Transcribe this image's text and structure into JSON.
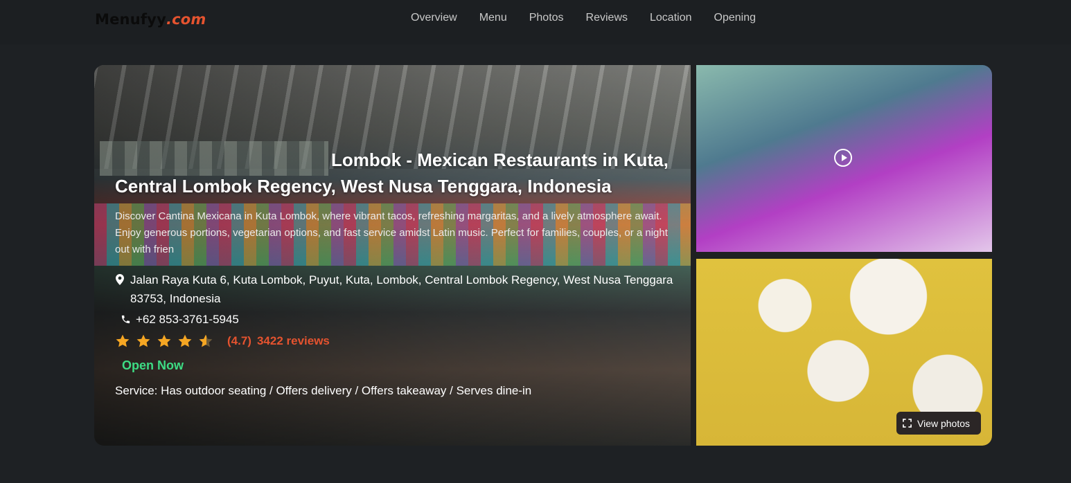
{
  "brand": {
    "name": "Menufyy",
    "tld": ".com"
  },
  "nav": [
    "Overview",
    "Menu",
    "Photos",
    "Reviews",
    "Location",
    "Opening"
  ],
  "restaurant": {
    "title": "Lombok - Mexican Restaurants in Kuta, Central Lombok Regency, West Nusa Tenggara, Indonesia",
    "description": "Discover Cantina Mexicana in Kuta Lombok, where vibrant tacos, refreshing margaritas, and a lively atmosphere await. Enjoy generous portions, vegetarian options, and fast service amidst Latin music. Perfect for families, couples, or a night out with frien",
    "address": "Jalan Raya Kuta 6, Kuta Lombok, Puyut, Kuta, Lombok, Central Lombok Regency, West Nusa Tenggara 83753, Indonesia",
    "phone": "+62 853-3761-5945",
    "rating": 4.7,
    "rating_text": "(4.7)",
    "reviews_text": "3422 reviews",
    "status": "Open Now",
    "service": "Service: Has outdoor seating / Offers delivery / Offers takeaway / Serves dine-in"
  },
  "view_photos_label": "View photos",
  "icons": {
    "location": "map-pin-icon",
    "phone": "phone-icon",
    "star": "star-icon",
    "play": "play-icon",
    "expand": "expand-icon"
  },
  "colors": {
    "accent": "#e5532f",
    "open": "#3ddc84",
    "star": "#f5a623",
    "background": "#1e2124"
  }
}
